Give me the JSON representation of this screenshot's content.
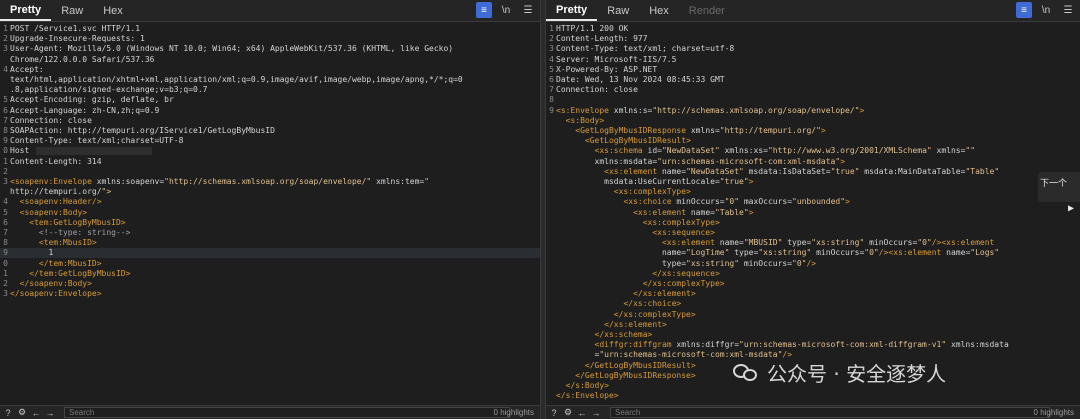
{
  "request_pane": {
    "tabs": [
      "Pretty",
      "Raw",
      "Hex"
    ],
    "active_tab": "Pretty",
    "icons": [
      "wrap-icon",
      "newline-icon",
      "menu-icon"
    ],
    "newline_label": "\\n",
    "lines": [
      {
        "n": "1",
        "text": "POST /Service1.svc HTTP/1.1"
      },
      {
        "n": "2",
        "text": "Upgrade-Insecure-Requests: 1"
      },
      {
        "n": "3",
        "text": "User-Agent: Mozilla/5.0 (Windows NT 10.0; Win64; x64) AppleWebKit/537.36 (KHTML, like Gecko)"
      },
      {
        "n": "",
        "text": "Chrome/122.0.0.0 Safari/537.36"
      },
      {
        "n": "4",
        "text": "Accept:"
      },
      {
        "n": "",
        "text": "text/html,application/xhtml+xml,application/xml;q=0.9,image/avif,image/webp,image/apng,*/*;q=0"
      },
      {
        "n": "",
        "text": ".8,application/signed-exchange;v=b3;q=0.7"
      },
      {
        "n": "5",
        "text": "Accept-Encoding: gzip, deflate, br"
      },
      {
        "n": "6",
        "text": "Accept-Language: zh-CN,zh;q=0.9"
      },
      {
        "n": "7",
        "text": "Connection: close"
      },
      {
        "n": "8",
        "text": "SOAPAction: http://tempuri.org/IService1/GetLogByMbusID"
      },
      {
        "n": "9",
        "text": "Content-Type: text/xml;charset=UTF-8"
      },
      {
        "n": "0",
        "text": "Host"
      },
      {
        "n": "1",
        "text": "Content-Length: 314"
      },
      {
        "n": "2",
        "text": ""
      },
      {
        "n": "3",
        "text": "<soapenv:Envelope xmlns:soapenv=\"http://schemas.xmlsoap.org/soap/envelope/\" xmlns:tem=\""
      },
      {
        "n": "",
        "text": "http://tempuri.org/\">"
      },
      {
        "n": "4",
        "text": "  <soapenv:Header/>"
      },
      {
        "n": "5",
        "text": "  <soapenv:Body>"
      },
      {
        "n": "6",
        "text": "    <tem:GetLogByMbusID>"
      },
      {
        "n": "7",
        "text": "      <!--type: string-->"
      },
      {
        "n": "8",
        "text": "      <tem:MbusID>"
      },
      {
        "n": "9",
        "text": "        1"
      },
      {
        "n": "0",
        "text": "      </tem:MbusID>"
      },
      {
        "n": "1",
        "text": "    </tem:GetLogByMbusID>"
      },
      {
        "n": "2",
        "text": "  </soapenv:Body>"
      },
      {
        "n": "3",
        "text": "</soapenv:Envelope>"
      }
    ],
    "search_placeholder": "Search",
    "highlights": "0 highlights"
  },
  "response_pane": {
    "tabs": [
      "Pretty",
      "Raw",
      "Hex",
      "Render"
    ],
    "active_tab": "Pretty",
    "newline_label": "\\n",
    "lines": [
      {
        "n": "1",
        "text": "HTTP/1.1 200 OK"
      },
      {
        "n": "2",
        "text": "Content-Length: 977"
      },
      {
        "n": "3",
        "text": "Content-Type: text/xml; charset=utf-8"
      },
      {
        "n": "4",
        "text": "Server: Microsoft-IIS/7.5"
      },
      {
        "n": "5",
        "text": "X-Powered-By: ASP.NET"
      },
      {
        "n": "6",
        "text": "Date: Wed, 13 Nov 2024 08:45:33 GMT"
      },
      {
        "n": "7",
        "text": "Connection: close"
      },
      {
        "n": "8",
        "text": ""
      },
      {
        "n": "9",
        "text": "<s:Envelope xmlns:s=\"http://schemas.xmlsoap.org/soap/envelope/\">"
      },
      {
        "n": "",
        "text": "  <s:Body>"
      },
      {
        "n": "",
        "text": "    <GetLogByMbusIDResponse xmlns=\"http://tempuri.org/\">"
      },
      {
        "n": "",
        "text": "      <GetLogByMbusIDResult>"
      },
      {
        "n": "",
        "text": "        <xs:schema id=\"NewDataSet\" xmlns:xs=\"http://www.w3.org/2001/XMLSchema\" xmlns=\"\""
      },
      {
        "n": "",
        "text": "        xmlns:msdata=\"urn:schemas-microsoft-com:xml-msdata\">"
      },
      {
        "n": "",
        "text": "          <xs:element name=\"NewDataSet\" msdata:IsDataSet=\"true\" msdata:MainDataTable=\"Table\""
      },
      {
        "n": "",
        "text": "          msdata:UseCurrentLocale=\"true\">"
      },
      {
        "n": "",
        "text": "            <xs:complexType>"
      },
      {
        "n": "",
        "text": "              <xs:choice minOccurs=\"0\" maxOccurs=\"unbounded\">"
      },
      {
        "n": "",
        "text": "                <xs:element name=\"Table\">"
      },
      {
        "n": "",
        "text": "                  <xs:complexType>"
      },
      {
        "n": "",
        "text": "                    <xs:sequence>"
      },
      {
        "n": "",
        "text": "                      <xs:element name=\"MBUSID\" type=\"xs:string\" minOccurs=\"0\"/><xs:element"
      },
      {
        "n": "",
        "text": "                      name=\"LogTime\" type=\"xs:string\" minOccurs=\"0\"/><xs:element name=\"Logs\""
      },
      {
        "n": "",
        "text": "                      type=\"xs:string\" minOccurs=\"0\"/>"
      },
      {
        "n": "",
        "text": "                    </xs:sequence>"
      },
      {
        "n": "",
        "text": "                  </xs:complexType>"
      },
      {
        "n": "",
        "text": "                </xs:element>"
      },
      {
        "n": "",
        "text": "              </xs:choice>"
      },
      {
        "n": "",
        "text": "            </xs:complexType>"
      },
      {
        "n": "",
        "text": "          </xs:element>"
      },
      {
        "n": "",
        "text": "        </xs:schema>"
      },
      {
        "n": "",
        "text": "        <diffgr:diffgram xmlns:diffgr=\"urn:schemas-microsoft-com:xml-diffgram-v1\" xmlns:msdata"
      },
      {
        "n": "",
        "text": "        =\"urn:schemas-microsoft-com:xml-msdata\"/>"
      },
      {
        "n": "",
        "text": "      </GetLogByMbusIDResult>"
      },
      {
        "n": "",
        "text": "    </GetLogByMbusIDResponse>"
      },
      {
        "n": "",
        "text": "  </s:Body>"
      },
      {
        "n": "",
        "text": "</s:Envelope>"
      }
    ],
    "search_placeholder": "Search",
    "highlights": "0 highlights"
  },
  "popup": {
    "label": "下一个"
  },
  "watermark": {
    "text": "公众号 · 安全逐梦人"
  }
}
